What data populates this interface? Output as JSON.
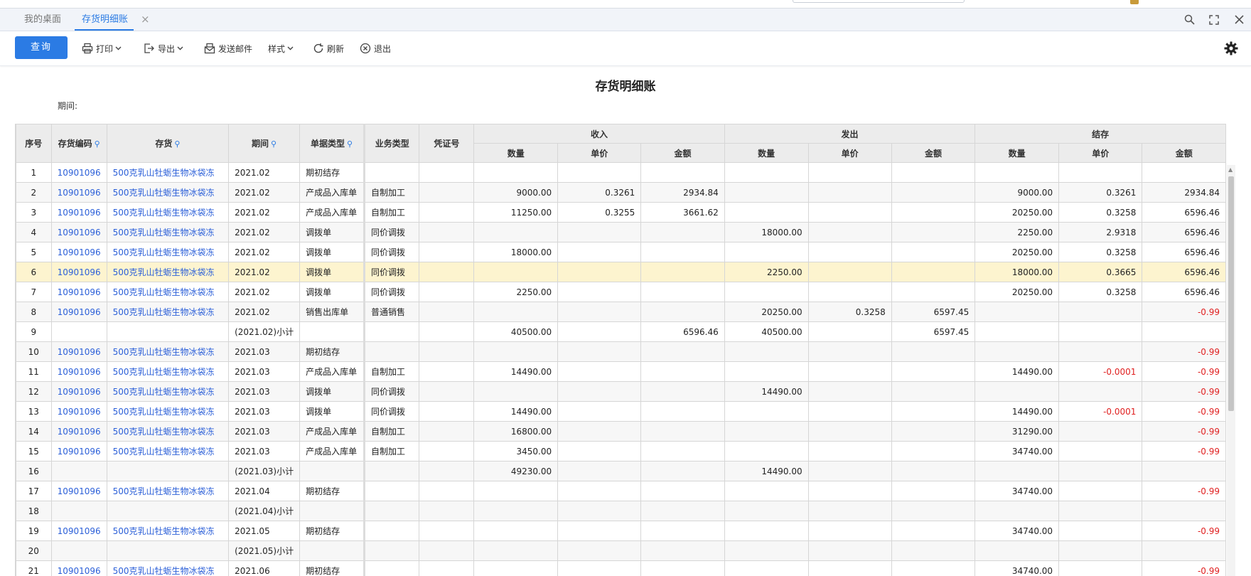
{
  "tabs": {
    "home": "我的桌面",
    "active": "存货明细账",
    "close_glyph": "×"
  },
  "toolbar": {
    "query": "查询",
    "print": "打印",
    "export": "导出",
    "send_mail": "发送邮件",
    "style": "样式",
    "refresh": "刷新",
    "exit": "退出"
  },
  "report": {
    "title": "存货明细账",
    "period_label": "期间:"
  },
  "columns": {
    "seq": "序号",
    "code": "存货编码",
    "item": "存货",
    "period": "期间",
    "doc_type": "单据类型",
    "biz_type": "业务类型",
    "voucher": "凭证号",
    "in": "收入",
    "out": "发出",
    "bal": "结存",
    "qty": "数量",
    "price": "单价",
    "amount": "金额"
  },
  "colors": {
    "accent": "#2b7be4",
    "link": "#2b5fd8",
    "negative": "#e02020",
    "highlight": "#fdf4cf"
  },
  "rows": [
    {
      "seq": "1",
      "code": "10901096",
      "item": "500克乳山牡蛎生物冰袋冻",
      "period": "2021.02",
      "doc": "期初结存",
      "biz": "",
      "voucher": "",
      "in_qty": "",
      "in_price": "",
      "in_amt": "",
      "out_qty": "",
      "out_price": "",
      "out_amt": "",
      "bal_qty": "",
      "bal_price": "",
      "bal_amt": ""
    },
    {
      "seq": "2",
      "code": "10901096",
      "item": "500克乳山牡蛎生物冰袋冻",
      "period": "2021.02",
      "doc": "产成品入库单",
      "biz": "自制加工",
      "voucher": "",
      "in_qty": "9000.00",
      "in_price": "0.3261",
      "in_amt": "2934.84",
      "out_qty": "",
      "out_price": "",
      "out_amt": "",
      "bal_qty": "9000.00",
      "bal_price": "0.3261",
      "bal_amt": "2934.84"
    },
    {
      "seq": "3",
      "code": "10901096",
      "item": "500克乳山牡蛎生物冰袋冻",
      "period": "2021.02",
      "doc": "产成品入库单",
      "biz": "自制加工",
      "voucher": "",
      "in_qty": "11250.00",
      "in_price": "0.3255",
      "in_amt": "3661.62",
      "out_qty": "",
      "out_price": "",
      "out_amt": "",
      "bal_qty": "20250.00",
      "bal_price": "0.3258",
      "bal_amt": "6596.46"
    },
    {
      "seq": "4",
      "code": "10901096",
      "item": "500克乳山牡蛎生物冰袋冻",
      "period": "2021.02",
      "doc": "调拨单",
      "biz": "同价调拨",
      "voucher": "",
      "in_qty": "",
      "in_price": "",
      "in_amt": "",
      "out_qty": "18000.00",
      "out_price": "",
      "out_amt": "",
      "bal_qty": "2250.00",
      "bal_price": "2.9318",
      "bal_amt": "6596.46"
    },
    {
      "seq": "5",
      "code": "10901096",
      "item": "500克乳山牡蛎生物冰袋冻",
      "period": "2021.02",
      "doc": "调拨单",
      "biz": "同价调拨",
      "voucher": "",
      "in_qty": "18000.00",
      "in_price": "",
      "in_amt": "",
      "out_qty": "",
      "out_price": "",
      "out_amt": "",
      "bal_qty": "20250.00",
      "bal_price": "0.3258",
      "bal_amt": "6596.46"
    },
    {
      "seq": "6",
      "code": "10901096",
      "item": "500克乳山牡蛎生物冰袋冻",
      "period": "2021.02",
      "doc": "调拨单",
      "biz": "同价调拨",
      "voucher": "",
      "in_qty": "",
      "in_price": "",
      "in_amt": "",
      "out_qty": "2250.00",
      "out_price": "",
      "out_amt": "",
      "bal_qty": "18000.00",
      "bal_price": "0.3665",
      "bal_amt": "6596.46",
      "hl": true
    },
    {
      "seq": "7",
      "code": "10901096",
      "item": "500克乳山牡蛎生物冰袋冻",
      "period": "2021.02",
      "doc": "调拨单",
      "biz": "同价调拨",
      "voucher": "",
      "in_qty": "2250.00",
      "in_price": "",
      "in_amt": "",
      "out_qty": "",
      "out_price": "",
      "out_amt": "",
      "bal_qty": "20250.00",
      "bal_price": "0.3258",
      "bal_amt": "6596.46"
    },
    {
      "seq": "8",
      "code": "10901096",
      "item": "500克乳山牡蛎生物冰袋冻",
      "period": "2021.02",
      "doc": "销售出库单",
      "biz": "普通销售",
      "voucher": "",
      "in_qty": "",
      "in_price": "",
      "in_amt": "",
      "out_qty": "20250.00",
      "out_price": "0.3258",
      "out_amt": "6597.45",
      "bal_qty": "",
      "bal_price": "",
      "bal_amt": "-0.99",
      "neg_amt": true
    },
    {
      "seq": "9",
      "code": "",
      "item": "",
      "period": "(2021.02)小计",
      "doc": "",
      "biz": "",
      "voucher": "",
      "in_qty": "40500.00",
      "in_price": "",
      "in_amt": "6596.46",
      "out_qty": "40500.00",
      "out_price": "",
      "out_amt": "6597.45",
      "bal_qty": "",
      "bal_price": "",
      "bal_amt": ""
    },
    {
      "seq": "10",
      "code": "10901096",
      "item": "500克乳山牡蛎生物冰袋冻",
      "period": "2021.03",
      "doc": "期初结存",
      "biz": "",
      "voucher": "",
      "in_qty": "",
      "in_price": "",
      "in_amt": "",
      "out_qty": "",
      "out_price": "",
      "out_amt": "",
      "bal_qty": "",
      "bal_price": "",
      "bal_amt": "-0.99",
      "neg_amt": true
    },
    {
      "seq": "11",
      "code": "10901096",
      "item": "500克乳山牡蛎生物冰袋冻",
      "period": "2021.03",
      "doc": "产成品入库单",
      "biz": "自制加工",
      "voucher": "",
      "in_qty": "14490.00",
      "in_price": "",
      "in_amt": "",
      "out_qty": "",
      "out_price": "",
      "out_amt": "",
      "bal_qty": "14490.00",
      "bal_price": "-0.0001",
      "bal_amt": "-0.99",
      "neg_price": true,
      "neg_amt": true
    },
    {
      "seq": "12",
      "code": "10901096",
      "item": "500克乳山牡蛎生物冰袋冻",
      "period": "2021.03",
      "doc": "调拨单",
      "biz": "同价调拨",
      "voucher": "",
      "in_qty": "",
      "in_price": "",
      "in_amt": "",
      "out_qty": "14490.00",
      "out_price": "",
      "out_amt": "",
      "bal_qty": "",
      "bal_price": "",
      "bal_amt": "-0.99",
      "neg_amt": true
    },
    {
      "seq": "13",
      "code": "10901096",
      "item": "500克乳山牡蛎生物冰袋冻",
      "period": "2021.03",
      "doc": "调拨单",
      "biz": "同价调拨",
      "voucher": "",
      "in_qty": "14490.00",
      "in_price": "",
      "in_amt": "",
      "out_qty": "",
      "out_price": "",
      "out_amt": "",
      "bal_qty": "14490.00",
      "bal_price": "-0.0001",
      "bal_amt": "-0.99",
      "neg_price": true,
      "neg_amt": true
    },
    {
      "seq": "14",
      "code": "10901096",
      "item": "500克乳山牡蛎生物冰袋冻",
      "period": "2021.03",
      "doc": "产成品入库单",
      "biz": "自制加工",
      "voucher": "",
      "in_qty": "16800.00",
      "in_price": "",
      "in_amt": "",
      "out_qty": "",
      "out_price": "",
      "out_amt": "",
      "bal_qty": "31290.00",
      "bal_price": "",
      "bal_amt": "-0.99",
      "neg_amt": true
    },
    {
      "seq": "15",
      "code": "10901096",
      "item": "500克乳山牡蛎生物冰袋冻",
      "period": "2021.03",
      "doc": "产成品入库单",
      "biz": "自制加工",
      "voucher": "",
      "in_qty": "3450.00",
      "in_price": "",
      "in_amt": "",
      "out_qty": "",
      "out_price": "",
      "out_amt": "",
      "bal_qty": "34740.00",
      "bal_price": "",
      "bal_amt": "-0.99",
      "neg_amt": true
    },
    {
      "seq": "16",
      "code": "",
      "item": "",
      "period": "(2021.03)小计",
      "doc": "",
      "biz": "",
      "voucher": "",
      "in_qty": "49230.00",
      "in_price": "",
      "in_amt": "",
      "out_qty": "14490.00",
      "out_price": "",
      "out_amt": "",
      "bal_qty": "",
      "bal_price": "",
      "bal_amt": ""
    },
    {
      "seq": "17",
      "code": "10901096",
      "item": "500克乳山牡蛎生物冰袋冻",
      "period": "2021.04",
      "doc": "期初结存",
      "biz": "",
      "voucher": "",
      "in_qty": "",
      "in_price": "",
      "in_amt": "",
      "out_qty": "",
      "out_price": "",
      "out_amt": "",
      "bal_qty": "34740.00",
      "bal_price": "",
      "bal_amt": "-0.99",
      "neg_amt": true
    },
    {
      "seq": "18",
      "code": "",
      "item": "",
      "period": "(2021.04)小计",
      "doc": "",
      "biz": "",
      "voucher": "",
      "in_qty": "",
      "in_price": "",
      "in_amt": "",
      "out_qty": "",
      "out_price": "",
      "out_amt": "",
      "bal_qty": "",
      "bal_price": "",
      "bal_amt": ""
    },
    {
      "seq": "19",
      "code": "10901096",
      "item": "500克乳山牡蛎生物冰袋冻",
      "period": "2021.05",
      "doc": "期初结存",
      "biz": "",
      "voucher": "",
      "in_qty": "",
      "in_price": "",
      "in_amt": "",
      "out_qty": "",
      "out_price": "",
      "out_amt": "",
      "bal_qty": "34740.00",
      "bal_price": "",
      "bal_amt": "-0.99",
      "neg_amt": true
    },
    {
      "seq": "20",
      "code": "",
      "item": "",
      "period": "(2021.05)小计",
      "doc": "",
      "biz": "",
      "voucher": "",
      "in_qty": "",
      "in_price": "",
      "in_amt": "",
      "out_qty": "",
      "out_price": "",
      "out_amt": "",
      "bal_qty": "",
      "bal_price": "",
      "bal_amt": ""
    },
    {
      "seq": "21",
      "code": "10901096",
      "item": "500克乳山牡蛎生物冰袋冻",
      "period": "2021.06",
      "doc": "期初结存",
      "biz": "",
      "voucher": "",
      "in_qty": "",
      "in_price": "",
      "in_amt": "",
      "out_qty": "",
      "out_price": "",
      "out_amt": "",
      "bal_qty": "34740.00",
      "bal_price": "",
      "bal_amt": "-0.99",
      "neg_amt": true
    }
  ]
}
